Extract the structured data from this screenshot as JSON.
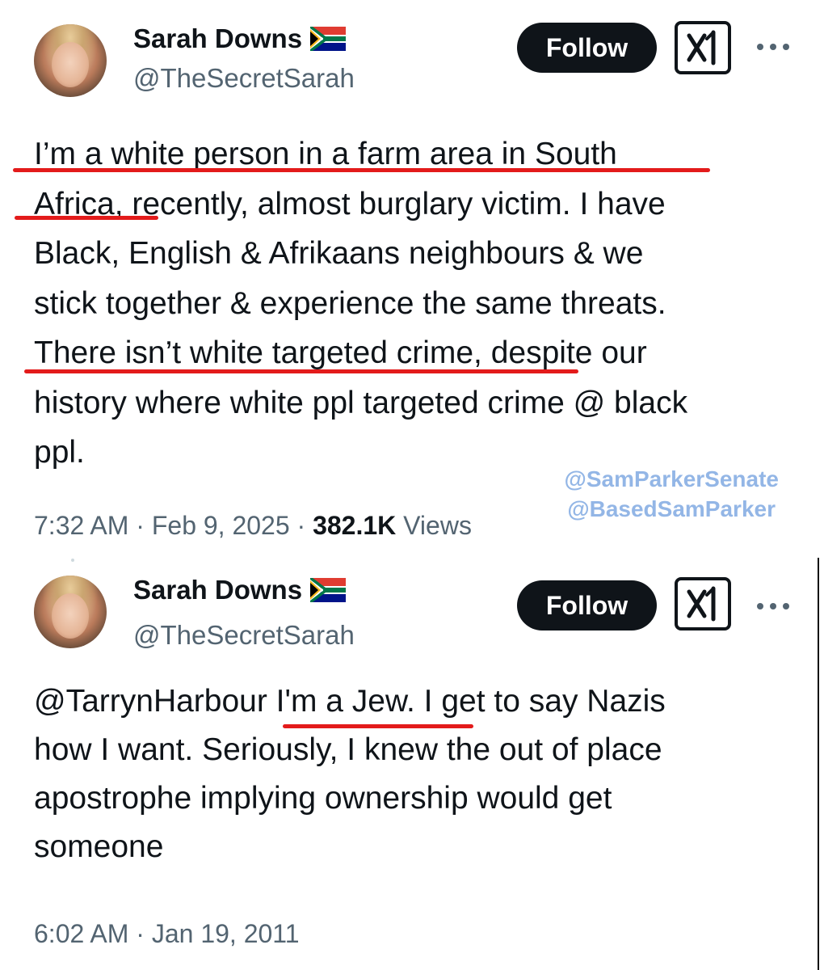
{
  "colors": {
    "accent_red": "#e31b1b",
    "watermark_blue": "#93b6e6",
    "secondary_text": "#536471",
    "primary_text": "#0f1419"
  },
  "tweets": [
    {
      "author": {
        "display_name": "Sarah Downs",
        "flag_icon": "south-africa-flag-icon",
        "handle": "@TheSecretSarah"
      },
      "follow_label": "Follow",
      "grok_icon": "grok-icon",
      "more_icon": "more-options-icon",
      "body_lines": [
        "I’m a white person in a farm area in South",
        "Africa, recently, almost burglary victim. I have",
        "Black, English & Afrikaans neighbours & we",
        "stick together & experience the same threats.",
        "There isn’t  white targeted crime, despite our",
        "history where white ppl targeted crime @ black",
        "ppl."
      ],
      "meta": {
        "time": "7:32 AM",
        "date": "Feb 9, 2025",
        "views_count": "382.1K",
        "views_label": "Views"
      }
    },
    {
      "author": {
        "display_name": "Sarah Downs",
        "flag_icon": "south-africa-flag-icon",
        "handle": "@TheSecretSarah"
      },
      "follow_label": "Follow",
      "grok_icon": "grok-icon",
      "more_icon": "more-options-icon",
      "body_lines": [
        "@TarrynHarbour I'm a Jew. I get to say Nazis",
        "how I want. Seriously, I knew the out of place",
        "apostrophe implying ownership would get",
        "someone"
      ],
      "meta": {
        "time": "6:02 AM",
        "date": "Jan 19, 2011"
      }
    }
  ],
  "watermark": {
    "line1": "@SamParkerSenate",
    "line2": "@BasedSamParker"
  },
  "separator": " · "
}
